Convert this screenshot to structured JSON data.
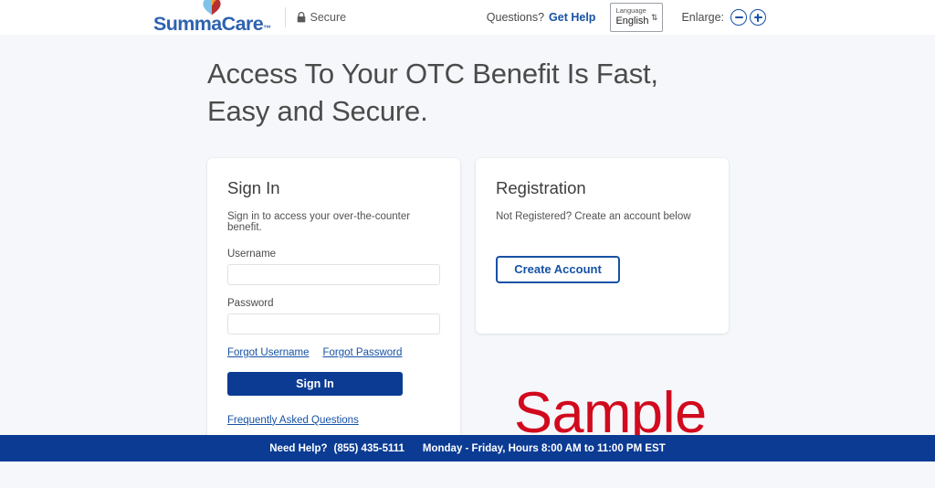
{
  "header": {
    "logo_word": "SummaCare",
    "logo_tm": "™",
    "logo_icon": "summacare-heart-icon",
    "secure_label": "Secure",
    "lock_icon": "lock-icon",
    "questions_label": "Questions?",
    "get_help_label": "Get Help",
    "language": {
      "label": "Language",
      "value": "English",
      "arrows": "⇅"
    },
    "enlarge_label": "Enlarge:",
    "zoom_out_icon": "minus-circle-icon",
    "zoom_in_icon": "plus-circle-icon"
  },
  "hero": {
    "title": "Access To Your OTC Benefit Is Fast, Easy and Secure."
  },
  "signin": {
    "title": "Sign In",
    "subtitle": "Sign in to access your over-the-counter benefit.",
    "username_label": "Username",
    "username_value": "",
    "username_placeholder": "",
    "password_label": "Password",
    "password_value": "",
    "password_placeholder": "",
    "forgot_username": "Forgot Username",
    "forgot_password": "Forgot Password",
    "submit_label": "Sign In",
    "faq_link": "Frequently Asked Questions"
  },
  "registration": {
    "title": "Registration",
    "subtitle": "Not Registered? Create an account below",
    "create_account_label": "Create Account"
  },
  "watermark": {
    "text": "Sample"
  },
  "footer": {
    "need_help_label": "Need Help?",
    "phone": "(855) 435-5111",
    "hours": "Monday - Friday, Hours 8:00 AM to 11:00 PM EST"
  },
  "colors": {
    "brand_blue": "#2e62b0",
    "link_blue": "#1652a5",
    "navy": "#0b3b93",
    "watermark_red": "#d10a1e",
    "page_bg": "#f5f7fa"
  }
}
